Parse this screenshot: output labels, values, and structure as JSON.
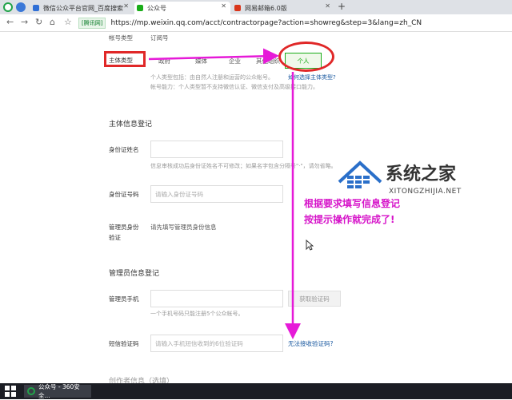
{
  "browser": {
    "tabs": [
      {
        "title": "微信公众平台官网_百度搜索",
        "favicon_color": "#2f6fd6"
      },
      {
        "title": "公众号",
        "favicon_color": "#1aad19"
      },
      {
        "title": "网易邮箱6.0版",
        "favicon_color": "#d9361c"
      }
    ],
    "new_tab": "+",
    "secure_label": "[腾讯网]",
    "url": "https://mp.weixin.qq.com/acct/contractorpage?action=showreg&step=3&lang=zh_CN"
  },
  "form": {
    "account_type_label": "帐号类型",
    "account_type_value": "订阅号",
    "subject_type_label": "主体类型",
    "subject_options": [
      "政府",
      "媒体",
      "企业",
      "其他组织",
      "个人"
    ],
    "selected_option": "个人",
    "personal_desc_1": "个人类型包括：由自然人注册和运营的公众帐号。",
    "personal_desc_link": "如何选择主体类型?",
    "personal_desc_2": "帐号能力：个人类型暂不支持微信认证、微信支付及高级接口能力。",
    "subject_section_title": "主体信息登记",
    "id_name_label": "身份证姓名",
    "id_name_hint": "信息审核成功后身份证姓名不可修改；如果名字包含分隔号\"·\"，请勿省略。",
    "id_number_label": "身份证号码",
    "id_number_placeholder": "请输入身份证号码",
    "admin_identity_label_1": "管理员身份",
    "admin_identity_label_2": "验证",
    "admin_identity_value": "请先填写管理员身份信息",
    "admin_section_title": "管理员信息登记",
    "admin_phone_label": "管理员手机",
    "get_code_button": "获取验证码",
    "phone_hint": "一个手机号码只能注册5个公众帐号。",
    "sms_code_label": "短信验证码",
    "sms_code_placeholder": "请输入手机短信收到的6位验证码",
    "sms_help_link": "无法接收验证码?",
    "operator_section_title": "创作者信息（选填）"
  },
  "annotation": {
    "line1": "根据要求填写信息登记",
    "line2": "按提示操作就完成了!",
    "color": "#e61ad8"
  },
  "watermark": {
    "title": "系统之家",
    "subtitle": "XITONGZHIJIA.NET"
  },
  "taskbar": {
    "item": "公众号 - 360安全..."
  }
}
